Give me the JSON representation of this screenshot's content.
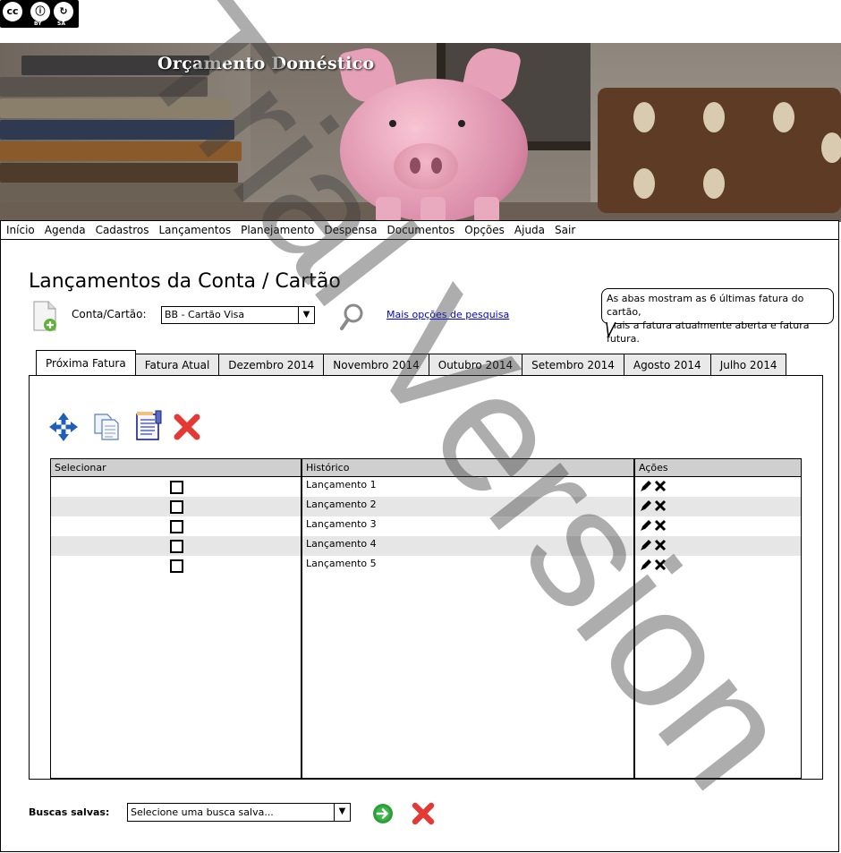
{
  "license_badge": {
    "by": "BY",
    "sa": "SA"
  },
  "app": {
    "title": "Orçamento Doméstico"
  },
  "menu": {
    "items": [
      "Início",
      "Agenda",
      "Cadastros",
      "Lançamentos",
      "Planejamento",
      "Despensa",
      "Documentos",
      "Opções",
      "Ajuda",
      "Sair"
    ]
  },
  "page": {
    "title": "Lançamentos da Conta / Cartão",
    "account_label": "Conta/Cartão:",
    "account_selected": "BB - Cartão Visa",
    "more_options_link": "Mais opções de pesquisa",
    "tooltip_line1": "As abas mostram as 6 últimas fatura do cartão,",
    "tooltip_line2": "mais a fatura atualmente aberta e fatura futura."
  },
  "tabs": [
    "Próxima Fatura",
    "Fatura Atual",
    "Dezembro 2014",
    "Novembro 2014",
    "Outubro 2014",
    "Setembro 2014",
    "Agosto 2014",
    "Julho 2014"
  ],
  "active_tab": "Próxima Fatura",
  "toolbar": {
    "icons": [
      "move-icon",
      "copy-icon",
      "report-icon",
      "delete-icon"
    ]
  },
  "grid": {
    "columns": [
      "Selecionar",
      "Histórico",
      "Ações"
    ],
    "rows": [
      {
        "historico": "Lançamento 1"
      },
      {
        "historico": "Lançamento 2"
      },
      {
        "historico": "Lançamento 3"
      },
      {
        "historico": "Lançamento 4"
      },
      {
        "historico": "Lançamento 5"
      }
    ],
    "row_actions": [
      "edit-icon",
      "delete-icon"
    ]
  },
  "saved_searches": {
    "label": "Buscas salvas:",
    "placeholder": "Selecione uma busca salva..."
  },
  "watermark": "Trial Version",
  "colors": {
    "tab_inactive": "#e9e9e9",
    "grid_header": "#cfcfcf",
    "row_alt": "#e6e6e6",
    "link": "#0000ee",
    "delete_red": "#e53935",
    "go_green": "#2e9e3a"
  }
}
